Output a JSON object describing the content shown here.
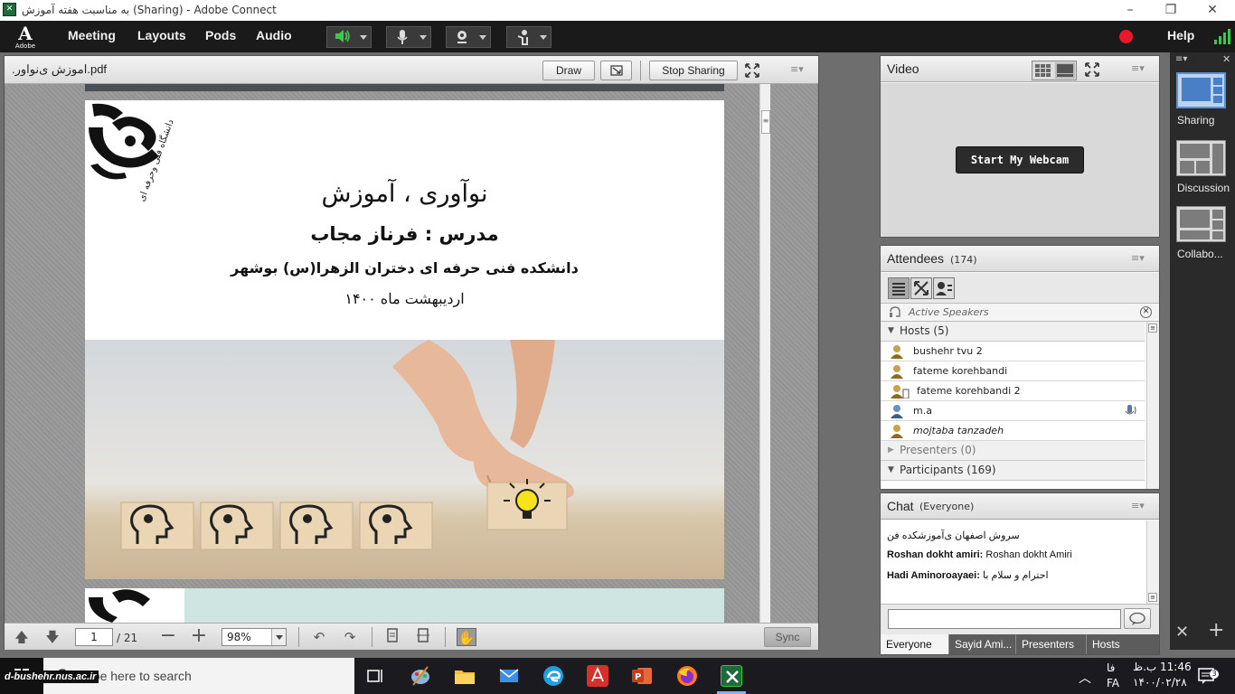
{
  "window": {
    "title": "به مناسبت هفته آموزش (Sharing) - Adobe Connect",
    "app_icon": "adobe-connect-icon",
    "minimize": "–",
    "maximize": "❐",
    "close": "✕"
  },
  "menubar": {
    "logo_letter": "A",
    "logo_text": "Adobe",
    "items": [
      "Meeting",
      "Layouts",
      "Pods",
      "Audio"
    ],
    "help": "Help",
    "speaker_color": "#3cc94a",
    "record_color": "#e8192c"
  },
  "share_pod": {
    "title": ".اموزش ی‌نواور.pdf",
    "draw": "Draw",
    "stop_sharing": "Stop Sharing",
    "slide": {
      "logo_text": "دانشگاه فنی وحرفه ای",
      "title": "نوآوری ، آموزش",
      "instructor": "مدرس : فرناز مجاب",
      "college": "دانشکده فنی حرفه ای دختران الزهرا(س) بوشهر",
      "date": "اردیبهشت ماه ۱۴۰۰"
    },
    "page_current": "1",
    "page_total": "/ 21",
    "zoom": "98%",
    "sync": "Sync"
  },
  "video_pod": {
    "title": "Video",
    "start_webcam": "Start My Webcam"
  },
  "attendees_pod": {
    "title": "Attendees",
    "count": "(174)",
    "active_speakers": "Active Speakers",
    "hosts_label": "Hosts (5)",
    "hosts": [
      {
        "name": "bushehr tvu 2",
        "mic": false
      },
      {
        "name": "fateme korehbandi",
        "mic": false
      },
      {
        "name": "fateme korehbandi 2",
        "mic": false
      },
      {
        "name": "m.a",
        "mic": true
      },
      {
        "name": "mojtaba tanzadeh",
        "mic": false
      }
    ],
    "presenters_label": "Presenters (0)",
    "participants_label": "Participants (169)"
  },
  "chat_pod": {
    "title": "Chat",
    "scope": "(Everyone)",
    "messages": [
      {
        "sender": "",
        "text": "سروش اصفهان ی‌آموزشکده فن"
      },
      {
        "sender": "Roshan dokht amiri:",
        "text": "Roshan dokht Amiri"
      },
      {
        "sender": "Hadi Aminoroayaei:",
        "text": "احترام و سلام با"
      }
    ],
    "tabs": [
      "Everyone",
      "Sayid Ami...",
      "Presenters",
      "Hosts"
    ]
  },
  "layouts": [
    {
      "name": "Sharing",
      "selected": true
    },
    {
      "name": "Discussion",
      "selected": false
    },
    {
      "name": "Collabo...",
      "selected": false
    }
  ],
  "taskbar": {
    "search_placeholder": "Type here to search",
    "watermark": "d-bushehr.nus.ac.ir",
    "time": "11:46 ب.ظ",
    "date": "۱۴۰۰/۰۲/۲۸",
    "lang1": "فا",
    "lang2": "FA"
  }
}
